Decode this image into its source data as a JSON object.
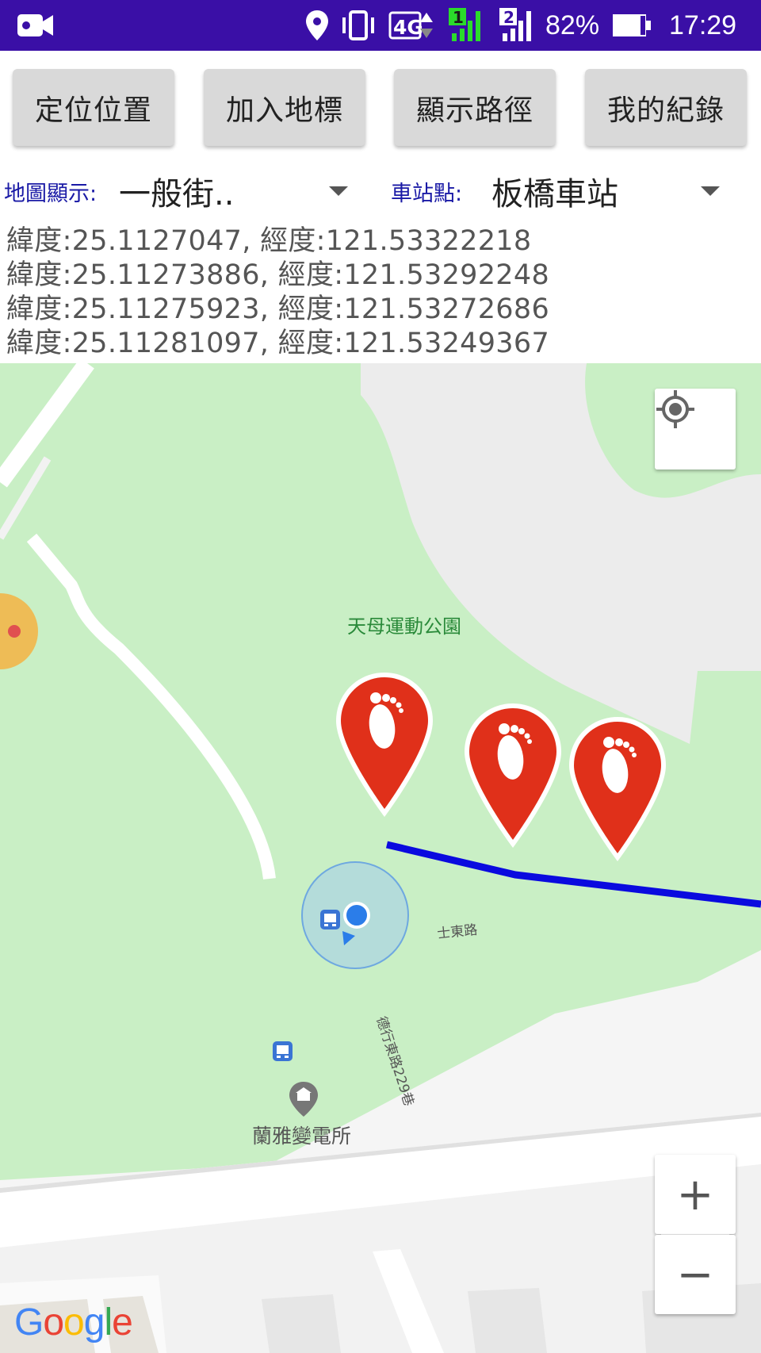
{
  "status_bar": {
    "battery": "82%",
    "time": "17:29",
    "network": "4G",
    "sim1": "1",
    "sim2": "2",
    "icons": [
      "video-camera-icon",
      "location-icon",
      "vibrate-icon",
      "network-4g-icon",
      "signal-sim1-icon",
      "signal-sim2-icon",
      "battery-icon"
    ]
  },
  "toolbar": {
    "buttons": [
      "定位位置",
      "加入地標",
      "顯示路徑",
      "我的紀錄"
    ]
  },
  "spinners": {
    "map_display_label": "地圖顯示:",
    "map_display_value": "一般街..",
    "station_label": "車站點:",
    "station_value": "板橋車站"
  },
  "coordinates": [
    "緯度:25.1127047, 經度:121.53322218",
    "緯度:25.11273886, 經度:121.53292248",
    "緯度:25.11275923, 經度:121.53272686",
    "緯度:25.11281097, 經度:121.53249367"
  ],
  "map": {
    "park_label": "天母運動公園",
    "road_label": "士東路",
    "lane_label": "德行東路229巷",
    "poi_label": "蘭雅變電所",
    "zoom_in": "+",
    "zoom_out": "−",
    "logo": "Google",
    "route_color": "#0a0adf",
    "marker_color": "#e0301a",
    "park_color": "#c8efc4"
  }
}
